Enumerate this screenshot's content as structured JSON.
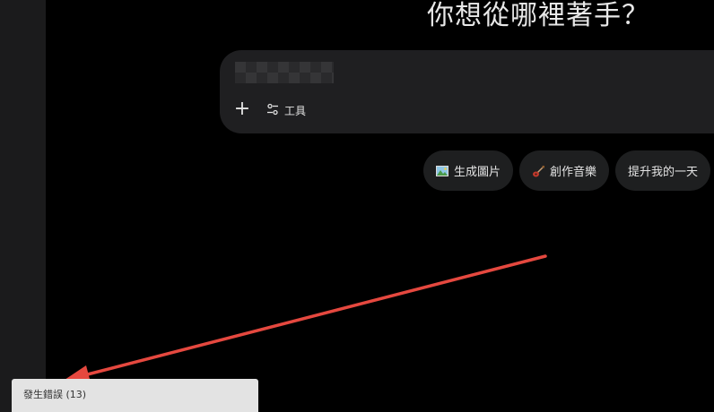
{
  "headline": "你想從哪裡著手？",
  "prompt": {
    "add_symbol": "+",
    "tools_label": "工具"
  },
  "chips": [
    {
      "label": "生成圖片",
      "icon": "image-icon"
    },
    {
      "label": "創作音樂",
      "icon": "guitar-icon"
    },
    {
      "label": "提升我的一天",
      "icon": ""
    }
  ],
  "toast": {
    "message": "發生錯誤 (13)"
  },
  "colors": {
    "background": "#000000",
    "sidebar": "#1b1b1c",
    "prompt_box": "#1f1f21",
    "chip": "#1e1f20",
    "annotation_arrow": "#e5483f",
    "toast_bg": "#e3e3e3"
  }
}
